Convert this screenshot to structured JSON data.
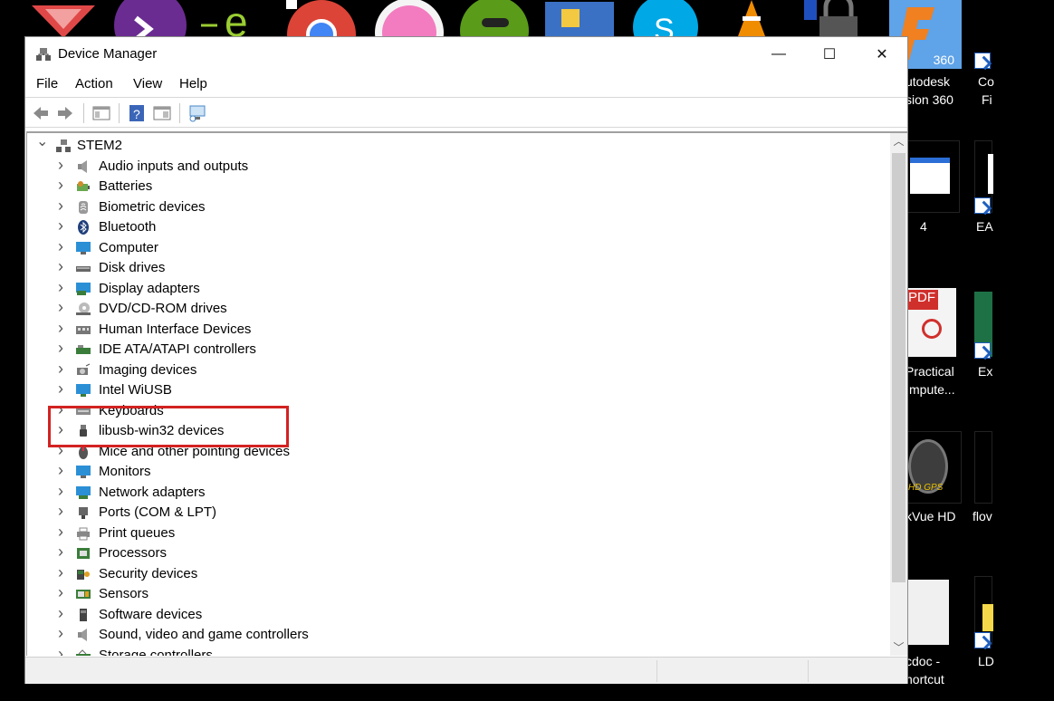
{
  "window": {
    "title": "Device Manager",
    "minimize_glyph": "—",
    "maximize_glyph": "☐",
    "close_glyph": "✕"
  },
  "menu": [
    "File",
    "Action",
    "View",
    "Help"
  ],
  "toolbar": {
    "buttons": [
      "back-arrow-icon",
      "forward-arrow-icon",
      "show-hide-console-tree-icon",
      "help-icon",
      "properties-icon",
      "scan-hardware-icon"
    ]
  },
  "tree": {
    "root": "STEM2",
    "items": [
      {
        "label": "Audio inputs and outputs",
        "icon": "speaker-icon"
      },
      {
        "label": "Batteries",
        "icon": "battery-icon"
      },
      {
        "label": "Biometric devices",
        "icon": "fingerprint-icon"
      },
      {
        "label": "Bluetooth",
        "icon": "bluetooth-icon"
      },
      {
        "label": "Computer",
        "icon": "monitor-icon"
      },
      {
        "label": "Disk drives",
        "icon": "disk-drive-icon"
      },
      {
        "label": "Display adapters",
        "icon": "display-adapter-icon"
      },
      {
        "label": "DVD/CD-ROM drives",
        "icon": "dvd-drive-icon"
      },
      {
        "label": "Human Interface Devices",
        "icon": "hid-icon"
      },
      {
        "label": "IDE ATA/ATAPI controllers",
        "icon": "ide-controller-icon"
      },
      {
        "label": "Imaging devices",
        "icon": "camera-icon"
      },
      {
        "label": "Intel WiUSB",
        "icon": "wireless-display-icon"
      },
      {
        "label": "Keyboards",
        "icon": "keyboard-icon"
      },
      {
        "label": "libusb-win32 devices",
        "icon": "usb-plug-icon"
      },
      {
        "label": "Mice and other pointing devices",
        "icon": "mouse-icon"
      },
      {
        "label": "Monitors",
        "icon": "monitor-icon"
      },
      {
        "label": "Network adapters",
        "icon": "network-adapter-icon"
      },
      {
        "label": "Ports (COM & LPT)",
        "icon": "port-icon"
      },
      {
        "label": "Print queues",
        "icon": "printer-icon"
      },
      {
        "label": "Processors",
        "icon": "processor-icon"
      },
      {
        "label": "Security devices",
        "icon": "security-device-icon"
      },
      {
        "label": "Sensors",
        "icon": "sensor-icon"
      },
      {
        "label": "Software devices",
        "icon": "software-device-icon"
      },
      {
        "label": "Sound, video and game controllers",
        "icon": "speaker-icon"
      },
      {
        "label": "Storage controllers",
        "icon": "storage-controller-icon"
      }
    ]
  },
  "desktop": {
    "labels": [
      {
        "line1": "utodesk",
        "line2": "sion 360"
      },
      {
        "line1": "Co",
        "line2": "Fi"
      },
      {
        "line1": "4",
        "line2": ""
      },
      {
        "line1": "EA",
        "line2": ""
      },
      {
        "line1": "Practical",
        "line2": "mpute..."
      },
      {
        "line1": "Ex",
        "line2": ""
      },
      {
        "line1": "kVue HD",
        "line2": ""
      },
      {
        "line1": "flov",
        "line2": ""
      },
      {
        "line1": "cdoc -",
        "line2": "hortcut"
      },
      {
        "line1": "LD",
        "line2": ""
      }
    ],
    "fusion_badge": "360",
    "pdf_badge": "PDF",
    "gps_badge": "HD GPS"
  },
  "colors": {
    "highlight": "#d32222",
    "desktop": "#000000",
    "window_bg": "#ffffff"
  }
}
